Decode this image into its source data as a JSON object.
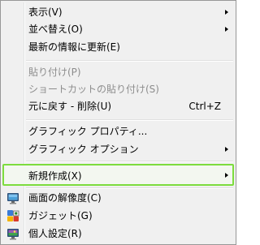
{
  "menu": {
    "view": "表示(V)",
    "sort": "並べ替え(O)",
    "refresh": "最新の情報に更新(E)",
    "paste": "貼り付け(P)",
    "paste_shortcut": "ショートカットの貼り付け(S)",
    "undo": "元に戻す - 削除(U)",
    "undo_shortcut": "Ctrl+Z",
    "graphics_properties": "グラフィック プロパティ...",
    "graphics_options": "グラフィック オプション",
    "new": "新規作成(X)",
    "screen_resolution": "画面の解像度(C)",
    "gadgets": "ガジェット(G)",
    "personalize": "個人設定(R)"
  },
  "icons": {
    "screen_resolution": "monitor-icon",
    "gadgets": "gadget-icon",
    "personalize": "personalize-monitor-icon"
  },
  "colors": {
    "menu_background": "#f0f0f0",
    "border": "#979797",
    "highlight_border": "#7ddc3e",
    "disabled_text": "#8d8d8d"
  }
}
